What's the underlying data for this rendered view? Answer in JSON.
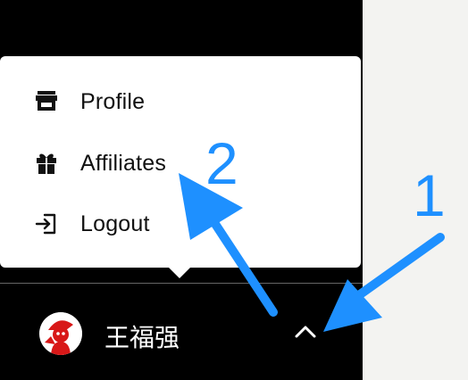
{
  "menu": {
    "items": [
      {
        "label": "Profile",
        "icon": "store-icon"
      },
      {
        "label": "Affiliates",
        "icon": "gift-icon"
      },
      {
        "label": "Logout",
        "icon": "logout-icon"
      }
    ]
  },
  "user": {
    "name": "王福强",
    "avatar": "avatar-image"
  },
  "toggle": {
    "icon": "chevron-up-icon"
  },
  "annotations": {
    "labels": [
      "1",
      "2"
    ],
    "color": "#1e90ff"
  }
}
